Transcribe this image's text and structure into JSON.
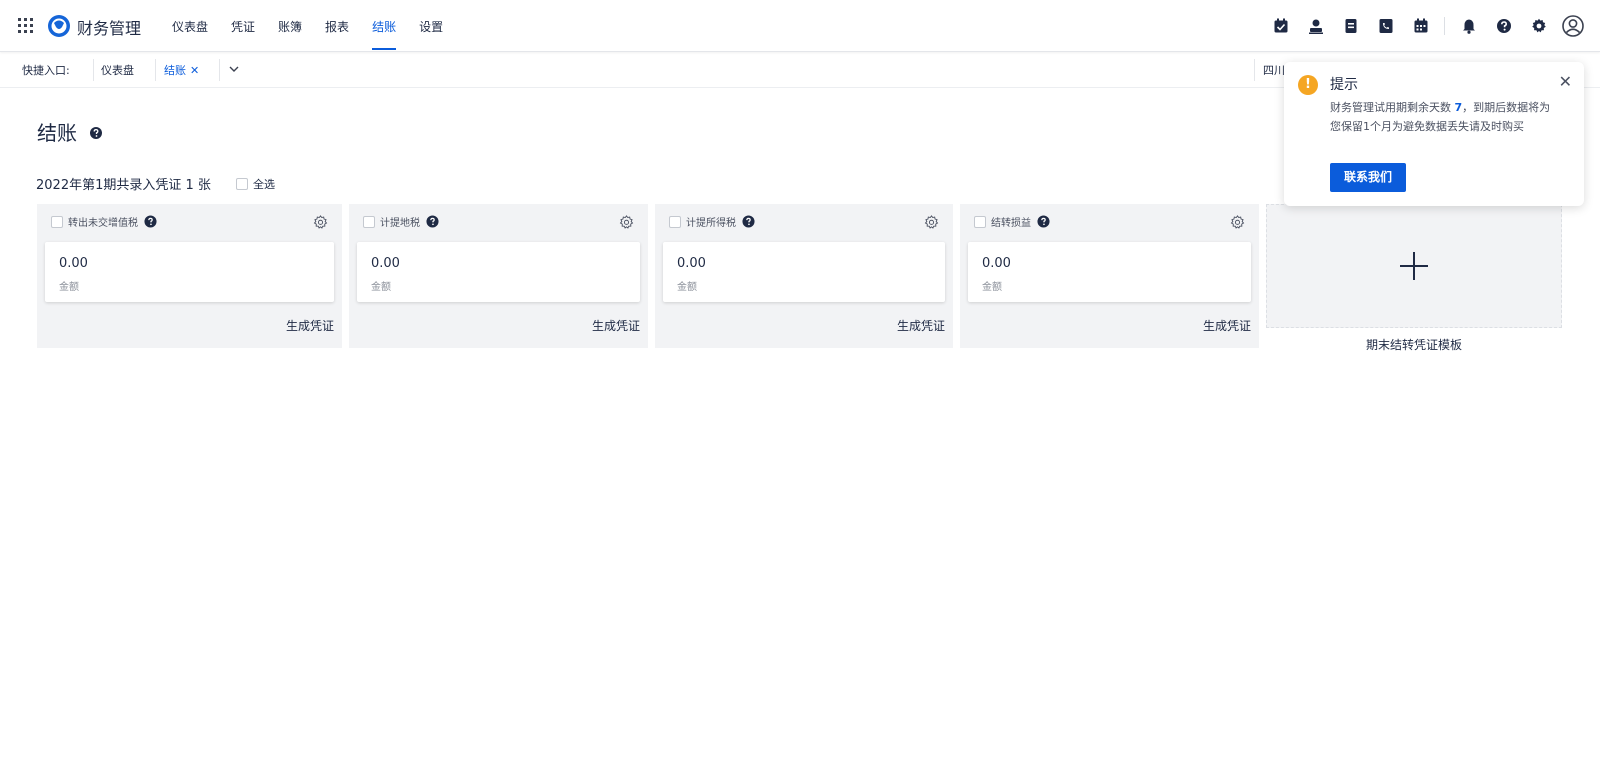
{
  "header": {
    "app_title": "财务管理",
    "nav": [
      {
        "label": "仪表盘",
        "active": false
      },
      {
        "label": "凭证",
        "active": false
      },
      {
        "label": "账簿",
        "active": false
      },
      {
        "label": "报表",
        "active": false
      },
      {
        "label": "结账",
        "active": true
      },
      {
        "label": "设置",
        "active": false
      }
    ],
    "right_icons": [
      "calendar-check-icon",
      "user-icon",
      "document-icon",
      "phone-icon",
      "calendar-icon",
      "bell-icon",
      "help-icon",
      "gear-icon",
      "account-icon"
    ],
    "accent_color": "#0b5cdb"
  },
  "quick_entry": {
    "label": "快捷入口:",
    "tabs": [
      {
        "label": "仪表盘",
        "active": false,
        "closable": false
      },
      {
        "label": "结账",
        "active": true,
        "closable": true,
        "close_glyph": "✕"
      }
    ],
    "company": "四川"
  },
  "page": {
    "title": "结账",
    "summary": "2022年第1期共录入凭证 1 张",
    "select_all": "全选",
    "cards": [
      {
        "title": "转出未交增值税",
        "amount": "0.00",
        "amount_label": "金额",
        "action": "生成凭证"
      },
      {
        "title": "计提地税",
        "amount": "0.00",
        "amount_label": "金额",
        "action": "生成凭证"
      },
      {
        "title": "计提所得税",
        "amount": "0.00",
        "amount_label": "金额",
        "action": "生成凭证"
      },
      {
        "title": "结转损益",
        "amount": "0.00",
        "amount_label": "金额",
        "action": "生成凭证"
      }
    ],
    "add_template_label": "期末结转凭证模板"
  },
  "toast": {
    "title": "提示",
    "message_pre": "财务管理试用期剩余天数 ",
    "days": "7",
    "message_post": "，到期后数据将为您保留1个月为避免数据丢失请及时购买",
    "button": "联系我们",
    "warn_color": "#f5a623"
  }
}
